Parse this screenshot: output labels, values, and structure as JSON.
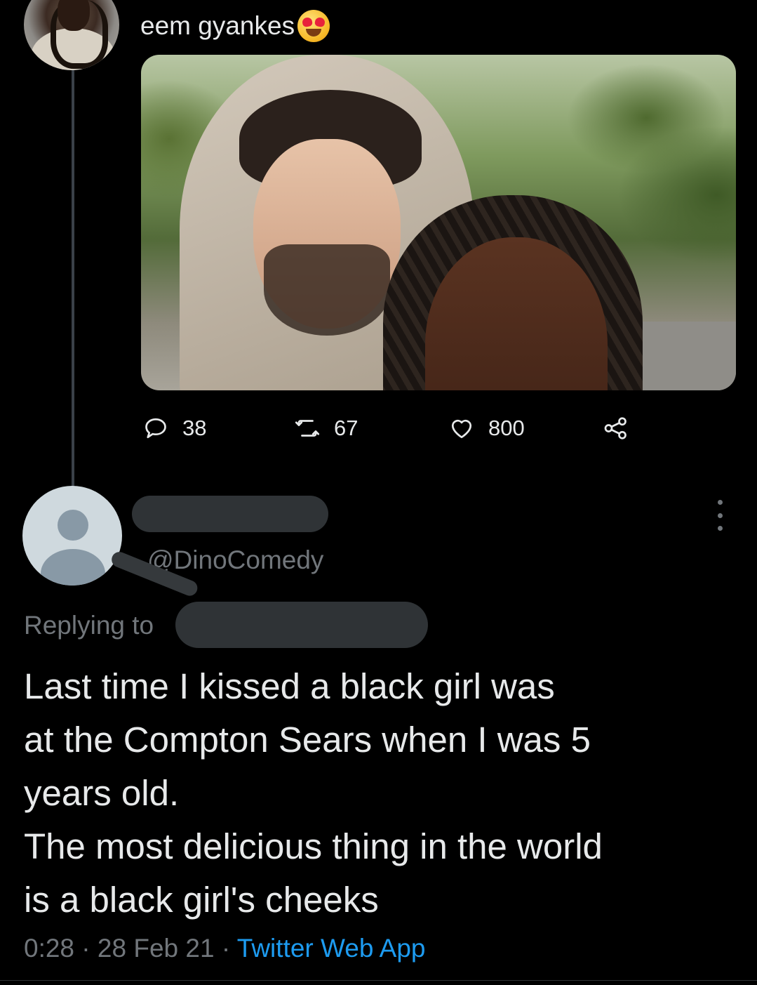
{
  "tweet": {
    "text": "eem gyankes",
    "emoji": "heart-eyes-emoji",
    "stats": {
      "replies": "38",
      "retweets": "67",
      "likes": "800"
    }
  },
  "reply": {
    "handle": "@DinoComedy",
    "replying_prefix": "Replying to",
    "body_lines": [
      "Last time I kissed a black girl was",
      "at the Compton Sears when I was 5",
      "years old.",
      "The most delicious thing in the world",
      "is a black girl's cheeks"
    ],
    "time": "0:28",
    "sep1": " · ",
    "date": "28 Feb 21",
    "sep2": " · ",
    "source": "Twitter Web App"
  },
  "colors": {
    "background": "#000000",
    "text": "#e7e9ea",
    "muted": "#71767b",
    "link": "#1d9bf0",
    "redaction": "#2f3336"
  }
}
